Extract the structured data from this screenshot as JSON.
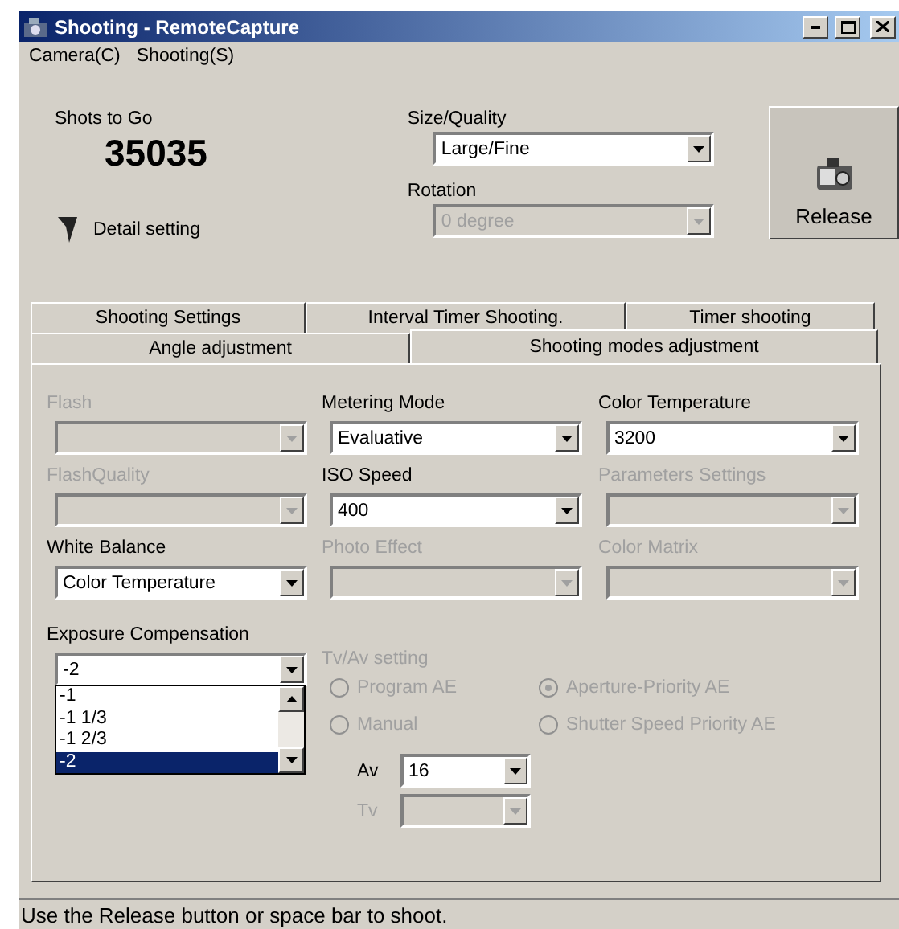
{
  "window": {
    "title": "Shooting - RemoteCapture"
  },
  "menu": [
    "Camera(C)",
    "Shooting(S)"
  ],
  "shots": {
    "label": "Shots to Go",
    "value": "35035"
  },
  "detail": {
    "label": "Detail setting"
  },
  "size_quality": {
    "label": "Size/Quality",
    "value": "Large/Fine",
    "disabled": false
  },
  "rotation": {
    "label": "Rotation",
    "value": "0 degree",
    "disabled": true
  },
  "release": {
    "label": "Release"
  },
  "tab_rows": [
    [
      {
        "label": "Shooting Settings",
        "selected": false
      },
      {
        "label": "Interval Timer Shooting.",
        "selected": false
      },
      {
        "label": "Timer shooting",
        "selected": false
      }
    ],
    [
      {
        "label": "Angle adjustment",
        "selected": false
      },
      {
        "label": "Shooting modes adjustment",
        "selected": true
      }
    ]
  ],
  "fields": [
    {
      "label": "Flash",
      "disabled": true
    },
    {
      "label": "Metering Mode",
      "value": "Evaluative",
      "disabled": false
    },
    {
      "label": "Color Temperature",
      "value": "3200",
      "disabled": false
    },
    {
      "label": "FlashQuality",
      "disabled": true
    },
    {
      "label": "ISO Speed",
      "value": "400",
      "disabled": false
    },
    {
      "label": "Parameters Settings",
      "disabled": true
    },
    {
      "label": "White Balance",
      "value": "Color Temperature",
      "disabled": false
    },
    {
      "label": "Photo Effect",
      "disabled": true
    },
    {
      "label": "Color Matrix",
      "disabled": true
    }
  ],
  "exposure": {
    "label": "Exposure Compensation",
    "value": "-2",
    "options": [
      {
        "text": "-1",
        "selected": false
      },
      {
        "text": "-1 1/3",
        "selected": false
      },
      {
        "text": "-1 2/3",
        "selected": false
      },
      {
        "text": "-2",
        "selected": true
      }
    ]
  },
  "tv_av": {
    "label": "Tv/Av setting",
    "disabled": true,
    "modes": [
      {
        "label": "Program AE",
        "selected": false
      },
      {
        "label": "Aperture-Priority AE",
        "selected": true
      },
      {
        "label": "Manual",
        "selected": false
      },
      {
        "label": "Shutter Speed Priority AE",
        "selected": false
      }
    ]
  },
  "av": {
    "label": "Av",
    "value": "16",
    "disabled": false
  },
  "tv": {
    "label": "Tv",
    "disabled": true
  },
  "status_bar": "Use the Release button or space bar to shoot."
}
